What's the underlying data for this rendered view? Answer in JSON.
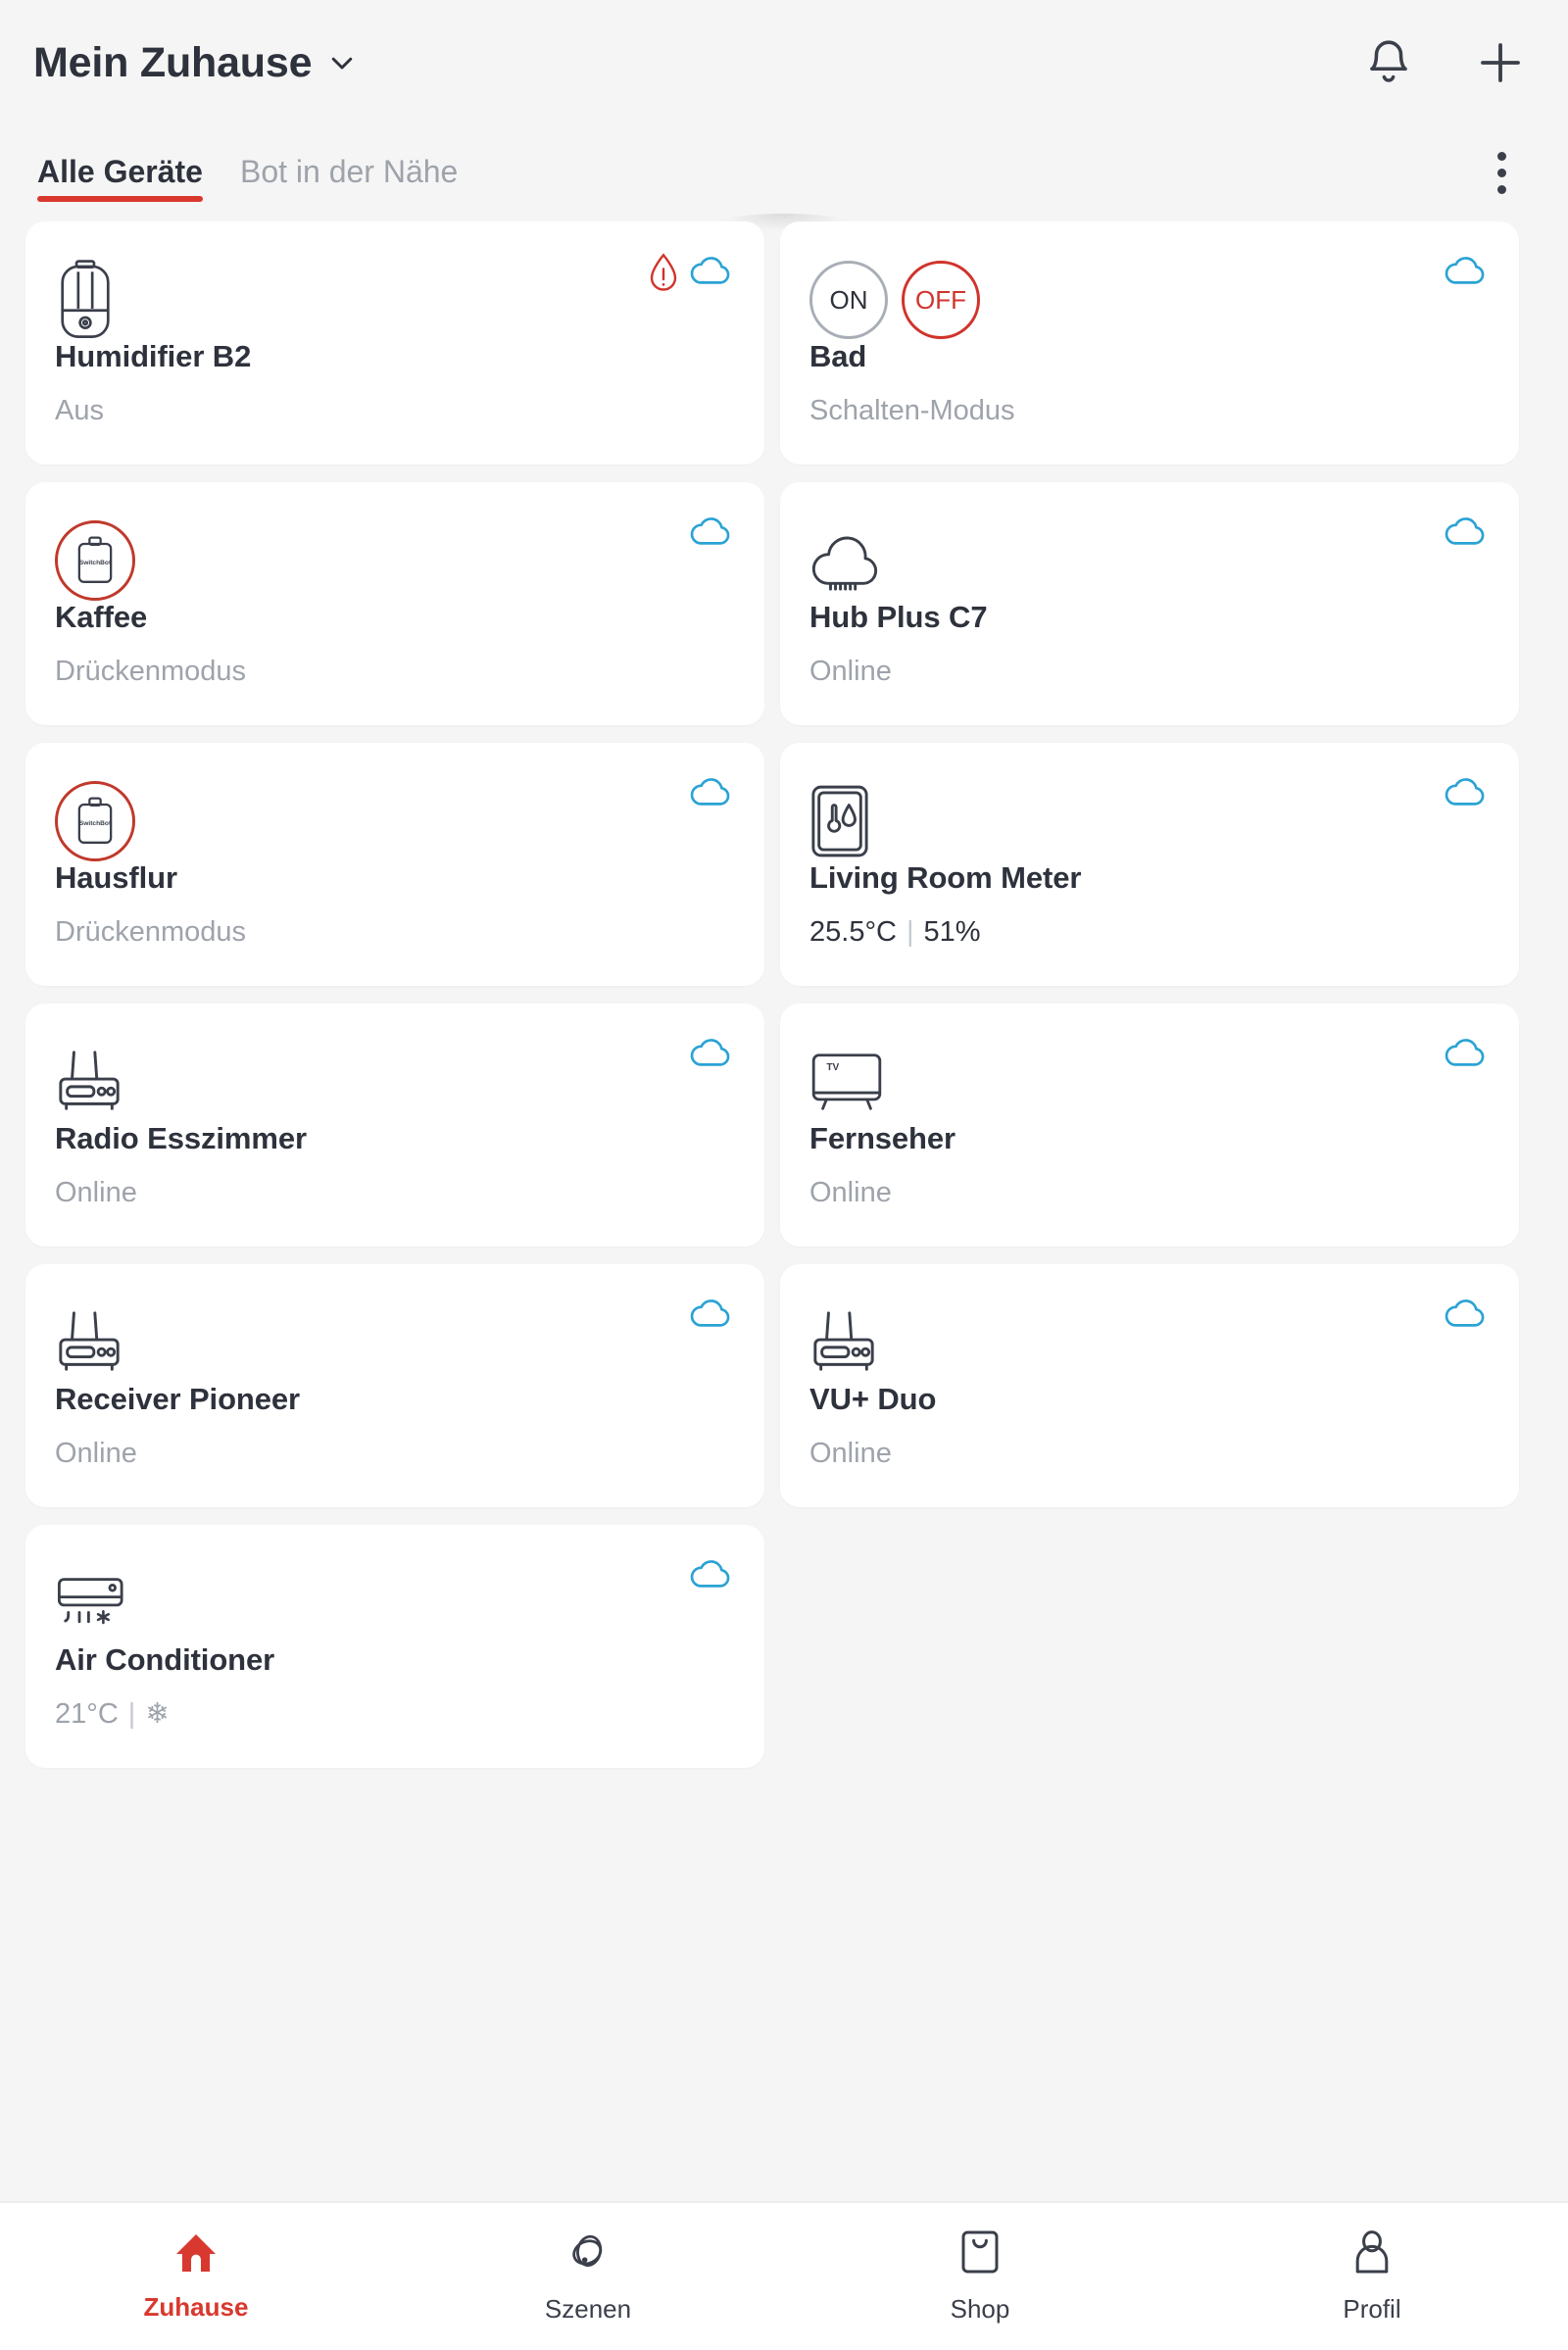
{
  "header": {
    "home_name": "Mein Zuhause",
    "chevron_icon": "chevron-down-icon",
    "bell_icon": "bell-icon",
    "plus_icon": "plus-icon"
  },
  "tabs": [
    {
      "label": "Alle Geräte",
      "active": true
    },
    {
      "label": "Bot in der Nähe",
      "active": false
    }
  ],
  "overflow_icon": "more-vertical-icon",
  "colors": {
    "accent_red": "#d9382e",
    "cloud_blue": "#2aa3d4",
    "warn_red": "#d0342c",
    "background": "#f5f5f5",
    "card": "#ffffff",
    "text_dark": "#2e323c",
    "text_muted": "#9ea3ab"
  },
  "devices": [
    {
      "name": "Humidifier B2",
      "status": "Aus",
      "status_dark": false,
      "icon": "humidifier-icon",
      "cloud": true,
      "warning": true,
      "warning_icon": "water-drop-alert-icon"
    },
    {
      "name": "Bad",
      "status": "Schalten-Modus",
      "status_dark": false,
      "icon": "onoff-buttons",
      "cloud": true,
      "warning": false,
      "on_label": "ON",
      "off_label": "OFF"
    },
    {
      "name": "Kaffee",
      "status": "Drückenmodus",
      "status_dark": false,
      "icon": "switchbot-bot-icon",
      "bot_label": "SwitchBot",
      "cloud": true,
      "warning": false
    },
    {
      "name": "Hub Plus C7",
      "status": "Online",
      "status_dark": false,
      "icon": "hub-plus-icon",
      "cloud": true,
      "warning": false
    },
    {
      "name": "Hausflur",
      "status": "Drückenmodus",
      "status_dark": false,
      "icon": "switchbot-bot-icon",
      "bot_label": "SwitchBot",
      "cloud": true,
      "warning": false
    },
    {
      "name": "Living Room Meter",
      "status": "25.5°C | 51%",
      "status_temp": "25.5°C",
      "status_humidity": "51%",
      "status_dark": true,
      "icon": "meter-icon",
      "cloud": true,
      "warning": false
    },
    {
      "name": "Radio Esszimmer",
      "status": "Online",
      "status_dark": false,
      "icon": "receiver-icon",
      "cloud": true,
      "warning": false
    },
    {
      "name": "Fernseher",
      "status": "Online",
      "status_dark": false,
      "icon": "tv-icon",
      "tv_label": "TV",
      "cloud": true,
      "warning": false
    },
    {
      "name": "Receiver Pioneer",
      "status": "Online",
      "status_dark": false,
      "icon": "receiver-icon",
      "cloud": true,
      "warning": false
    },
    {
      "name": "VU+ Duo",
      "status": "Online",
      "status_dark": false,
      "icon": "receiver-icon",
      "cloud": true,
      "warning": false
    },
    {
      "name": "Air Conditioner",
      "status": "21°C | ❄",
      "status_temp": "21°C",
      "status_mode": "❄",
      "status_dark": false,
      "icon": "air-conditioner-icon",
      "cloud": true,
      "warning": false
    }
  ],
  "bottom_nav": [
    {
      "label": "Zuhause",
      "icon": "home-icon",
      "active": true
    },
    {
      "label": "Szenen",
      "icon": "scene-icon",
      "active": false
    },
    {
      "label": "Shop",
      "icon": "shop-bag-icon",
      "active": false
    },
    {
      "label": "Profil",
      "icon": "person-icon",
      "active": false
    }
  ]
}
